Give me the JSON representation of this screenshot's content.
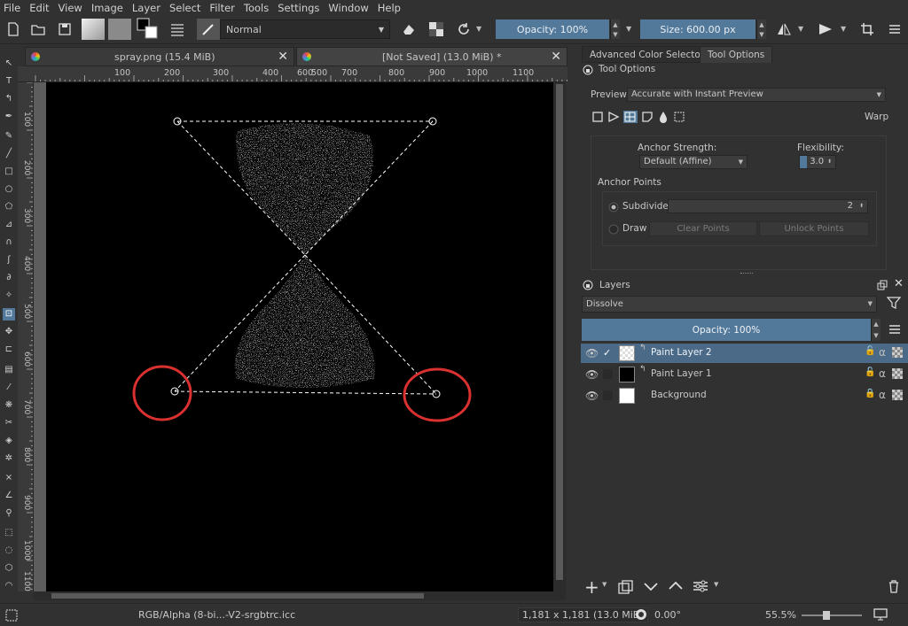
{
  "menu": [
    "File",
    "Edit",
    "View",
    "Image",
    "Layer",
    "Select",
    "Filter",
    "Tools",
    "Settings",
    "Window",
    "Help"
  ],
  "toolbar": {
    "blend_mode": "Normal",
    "opacity": "Opacity: 100%",
    "size": "Size: 600.00 px"
  },
  "tabs": [
    {
      "title": "spray.png (15.4 MiB)"
    },
    {
      "title": "[Not Saved]  (13.0 MiB) *"
    }
  ],
  "ruler": {
    "h_labels": [
      "100",
      "200",
      "300",
      "400",
      "500",
      "600",
      "700",
      "800",
      "900",
      "1000",
      "1100"
    ],
    "v_labels": [
      "100",
      "200",
      "300",
      "400",
      "500",
      "600",
      "700",
      "800",
      "900",
      "1000",
      "1100"
    ]
  },
  "panel_tabs": [
    "Advanced Color Selector",
    "Tool Options"
  ],
  "tool_options": {
    "title": "Tool Options",
    "preview_label": "Preview",
    "preview_value": "Accurate with Instant Preview",
    "mode_label": "Warp",
    "anchor_strength_label": "Anchor Strength:",
    "anchor_strength_value": "Default (Affine)",
    "flexibility_label": "Flexibility:",
    "flexibility_value": "3.0",
    "anchor_points_label": "Anchor Points",
    "subdivide_label": "Subdivide",
    "subdivide_value": "2",
    "draw_label": "Draw",
    "clear_points": "Clear Points",
    "unlock_points": "Unlock Points"
  },
  "layers": {
    "title": "Layers",
    "blend_mode": "Dissolve",
    "opacity": "Opacity:  100%",
    "items": [
      {
        "name": "Paint Layer 2",
        "selected": true
      },
      {
        "name": "Paint Layer 1",
        "selected": false
      },
      {
        "name": "Background",
        "selected": false
      }
    ]
  },
  "status": {
    "color_profile": "RGB/Alpha (8-bi...-V2-srgbtrc.icc",
    "dimensions": "1,181 x 1,181 (13.0 MiB)",
    "rotation": "0.00°",
    "zoom": "55.5%"
  },
  "colors": {
    "accent": "#53799a",
    "annotation": "#d93030"
  }
}
